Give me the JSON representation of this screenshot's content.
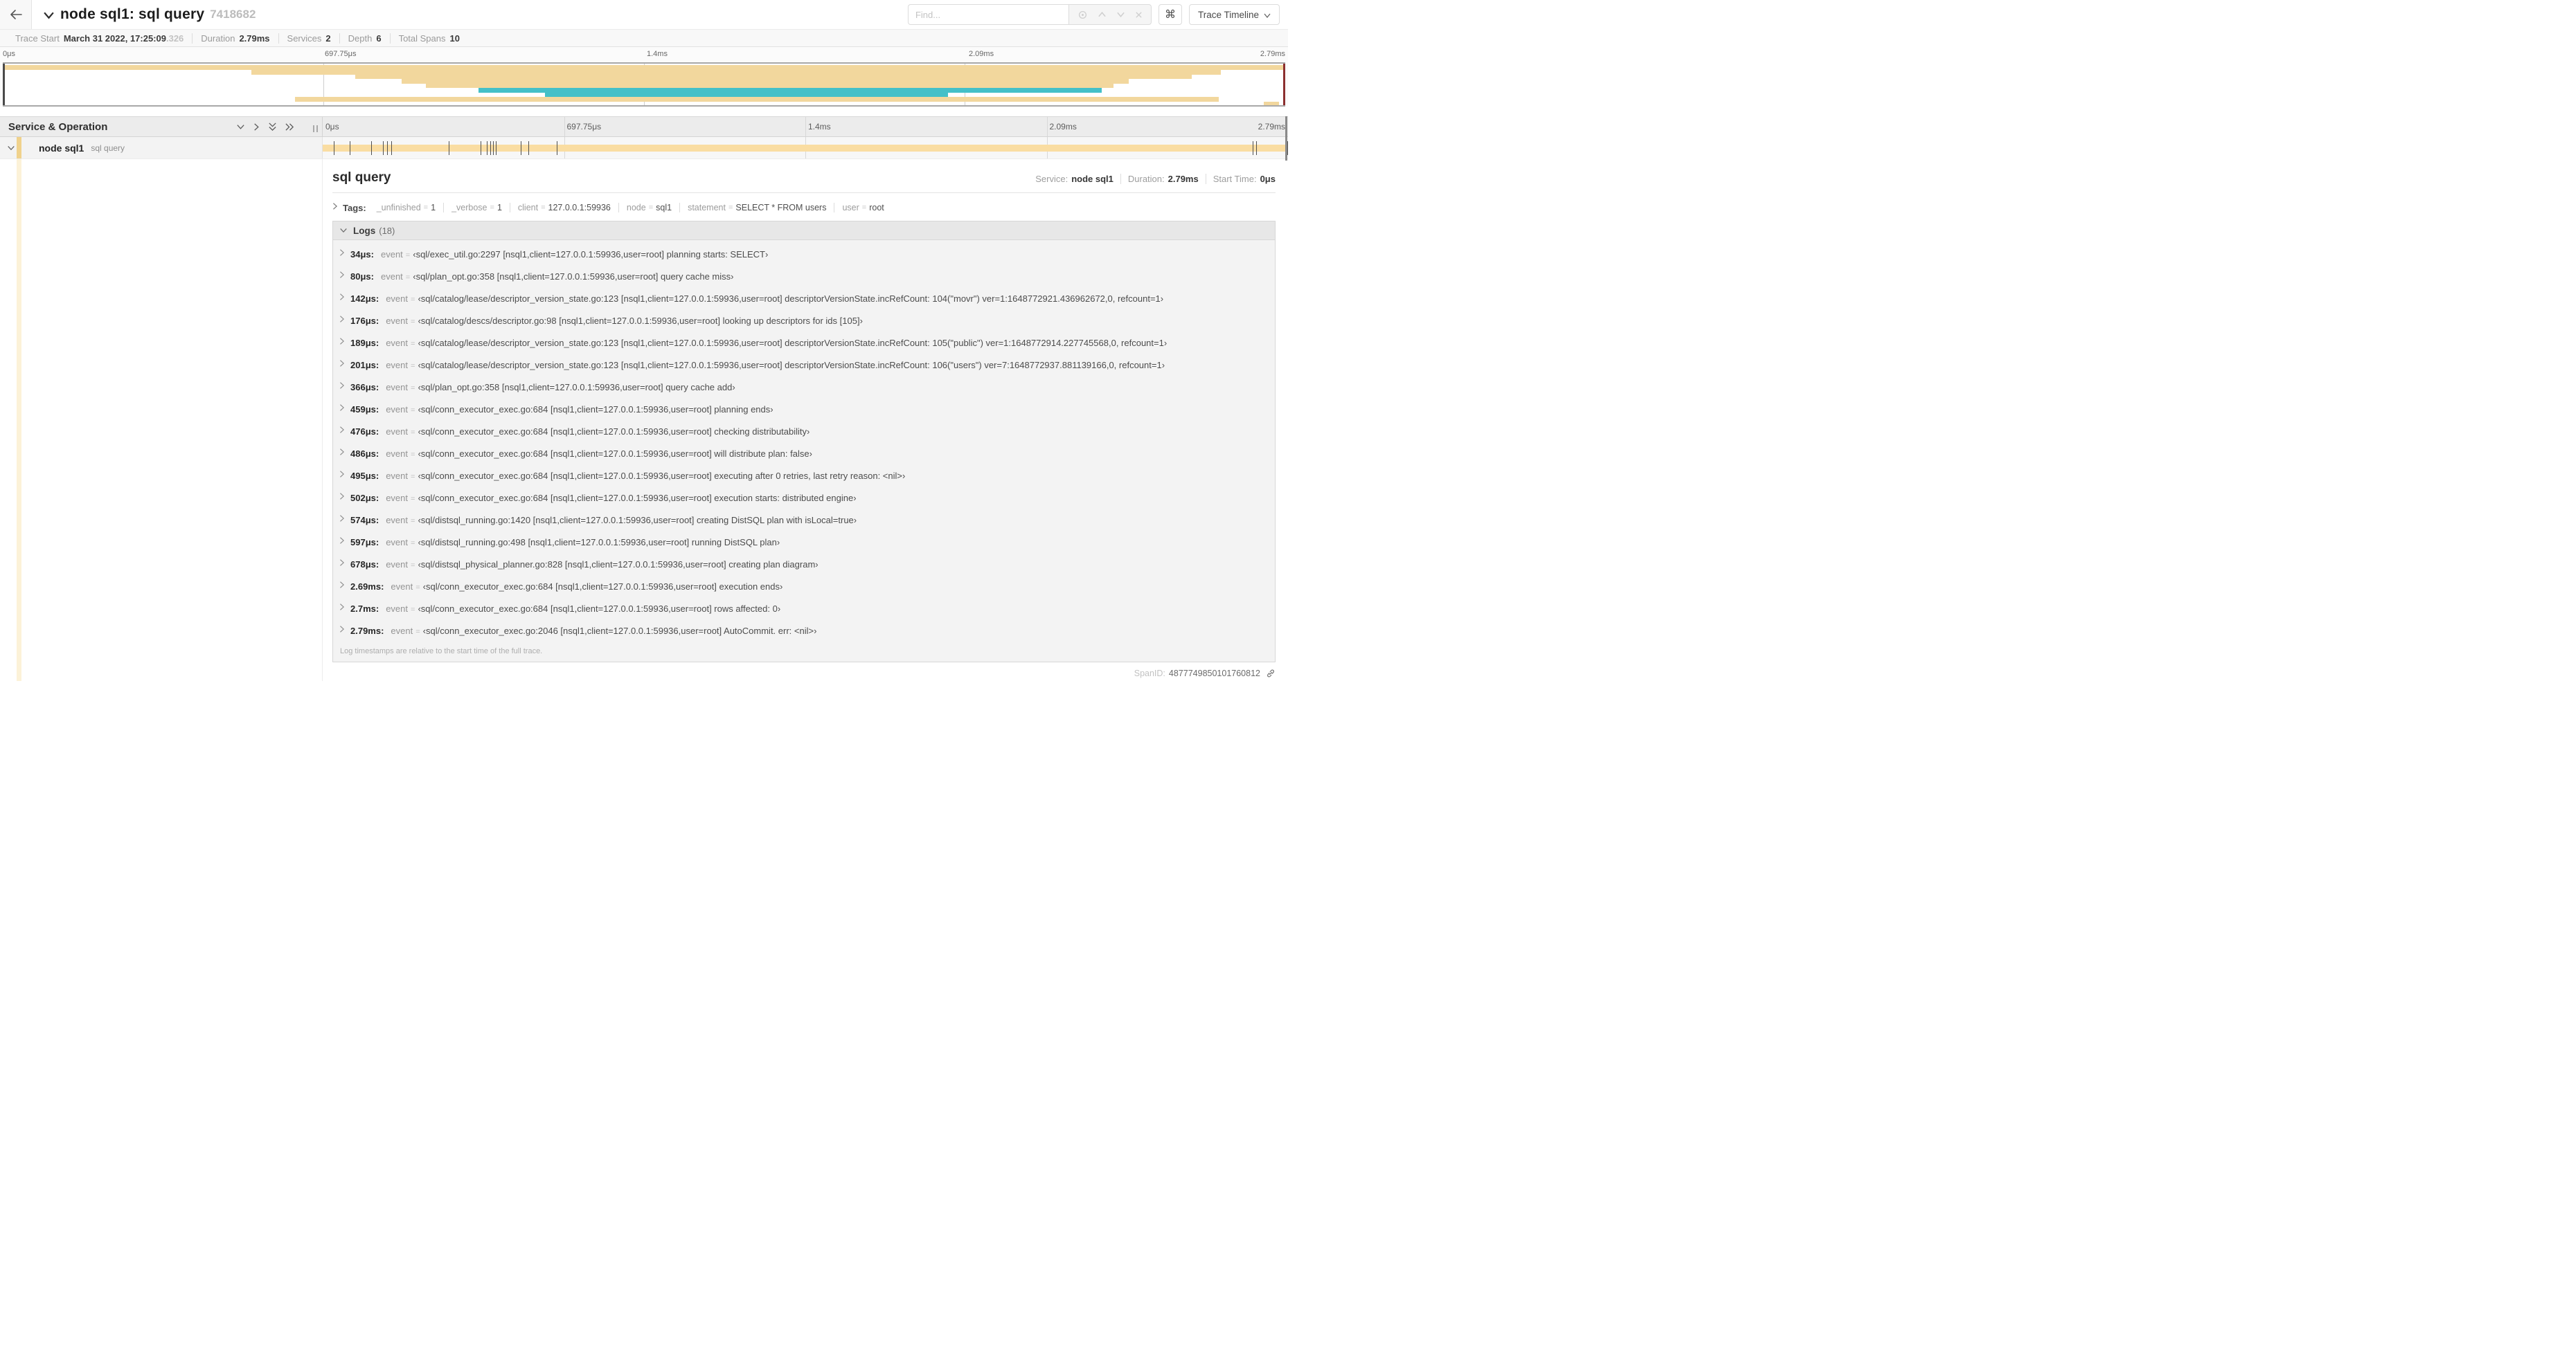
{
  "header": {
    "title": "node sql1: sql query",
    "trace_id": "7418682",
    "find_placeholder": "Find...",
    "shortcut_icon": "⌘",
    "view_label": "Trace Timeline"
  },
  "summary": {
    "items": [
      {
        "label": "Trace Start",
        "value": "March 31 2022, 17:25:09",
        "suffix": ".326"
      },
      {
        "label": "Duration",
        "value": "2.79ms"
      },
      {
        "label": "Services",
        "value": "2"
      },
      {
        "label": "Depth",
        "value": "6"
      },
      {
        "label": "Total Spans",
        "value": "10"
      }
    ]
  },
  "colors": {
    "span_tan": "#f2d79d",
    "span_teal": "#44c0c8",
    "bar_tan": "#fadda2",
    "accent_cream": "#fcf2d8",
    "accent_strong": "#f0d28c"
  },
  "time_ticks": [
    {
      "label": "0μs",
      "pos": 0
    },
    {
      "label": "697.75μs",
      "pos": 0.25
    },
    {
      "label": "1.4ms",
      "pos": 0.5
    },
    {
      "label": "2.09ms",
      "pos": 0.75
    },
    {
      "label": "2.79ms",
      "pos": 1
    }
  ],
  "minimap": {
    "spans": [
      {
        "row": 0,
        "start": 0.0,
        "end": 1.0,
        "color": "tan"
      },
      {
        "row": 1,
        "start": 0.194,
        "end": 0.95,
        "color": "tan"
      },
      {
        "row": 2,
        "start": 0.275,
        "end": 0.927,
        "color": "tan"
      },
      {
        "row": 3,
        "start": 0.311,
        "end": 0.878,
        "color": "tan"
      },
      {
        "row": 4,
        "start": 0.33,
        "end": 0.866,
        "color": "tan"
      },
      {
        "row": 5,
        "start": 0.371,
        "end": 0.857,
        "color": "teal"
      },
      {
        "row": 6,
        "start": 0.423,
        "end": 0.737,
        "color": "teal"
      },
      {
        "row": 7,
        "start": 0.228,
        "end": 0.948,
        "color": "tan"
      },
      {
        "row": 8,
        "start": 0.983,
        "end": 0.995,
        "color": "tan"
      }
    ]
  },
  "columns": {
    "service_header": "Service & Operation"
  },
  "span": {
    "service": "node sql1",
    "operation": "sql query",
    "duration_us": 2790,
    "log_tick_times_us": [
      34,
      80,
      142,
      176,
      189,
      201,
      366,
      459,
      476,
      486,
      495,
      502,
      574,
      597,
      678,
      2690,
      2700,
      2790
    ]
  },
  "detail": {
    "title": "sql query",
    "meta": [
      {
        "label": "Service:",
        "value": "node sql1"
      },
      {
        "label": "Duration:",
        "value": "2.79ms"
      },
      {
        "label": "Start Time:",
        "value": "0μs"
      }
    ],
    "tags_label": "Tags:",
    "tags": [
      {
        "key": "_unfinished",
        "value": "1"
      },
      {
        "key": "_verbose",
        "value": "1"
      },
      {
        "key": "client",
        "value": "127.0.0.1:59936"
      },
      {
        "key": "node",
        "value": "sql1"
      },
      {
        "key": "statement",
        "value": "SELECT * FROM users"
      },
      {
        "key": "user",
        "value": "root"
      }
    ],
    "logs_label": "Logs",
    "logs_count": "(18)",
    "formatting": {
      "eq": "=",
      "quote_open": "‹",
      "quote_close": "›"
    },
    "logs": [
      {
        "time": "34μs:",
        "key": "event",
        "value": "sql/exec_util.go:2297 [nsql1,client=127.0.0.1:59936,user=root] planning starts: SELECT"
      },
      {
        "time": "80μs:",
        "key": "event",
        "value": "sql/plan_opt.go:358 [nsql1,client=127.0.0.1:59936,user=root] query cache miss"
      },
      {
        "time": "142μs:",
        "key": "event",
        "value": "sql/catalog/lease/descriptor_version_state.go:123 [nsql1,client=127.0.0.1:59936,user=root] descriptorVersionState.incRefCount: 104(\"movr\") ver=1:1648772921.436962672,0, refcount=1"
      },
      {
        "time": "176μs:",
        "key": "event",
        "value": "sql/catalog/descs/descriptor.go:98 [nsql1,client=127.0.0.1:59936,user=root] looking up descriptors for ids [105]"
      },
      {
        "time": "189μs:",
        "key": "event",
        "value": "sql/catalog/lease/descriptor_version_state.go:123 [nsql1,client=127.0.0.1:59936,user=root] descriptorVersionState.incRefCount: 105(\"public\") ver=1:1648772914.227745568,0, refcount=1"
      },
      {
        "time": "201μs:",
        "key": "event",
        "value": "sql/catalog/lease/descriptor_version_state.go:123 [nsql1,client=127.0.0.1:59936,user=root] descriptorVersionState.incRefCount: 106(\"users\") ver=7:1648772937.881139166,0, refcount=1"
      },
      {
        "time": "366μs:",
        "key": "event",
        "value": "sql/plan_opt.go:358 [nsql1,client=127.0.0.1:59936,user=root] query cache add"
      },
      {
        "time": "459μs:",
        "key": "event",
        "value": "sql/conn_executor_exec.go:684 [nsql1,client=127.0.0.1:59936,user=root] planning ends"
      },
      {
        "time": "476μs:",
        "key": "event",
        "value": "sql/conn_executor_exec.go:684 [nsql1,client=127.0.0.1:59936,user=root] checking distributability"
      },
      {
        "time": "486μs:",
        "key": "event",
        "value": "sql/conn_executor_exec.go:684 [nsql1,client=127.0.0.1:59936,user=root] will distribute plan: false"
      },
      {
        "time": "495μs:",
        "key": "event",
        "value": "sql/conn_executor_exec.go:684 [nsql1,client=127.0.0.1:59936,user=root] executing after 0 retries, last retry reason: <nil>"
      },
      {
        "time": "502μs:",
        "key": "event",
        "value": "sql/conn_executor_exec.go:684 [nsql1,client=127.0.0.1:59936,user=root] execution starts: distributed engine"
      },
      {
        "time": "574μs:",
        "key": "event",
        "value": "sql/distsql_running.go:1420 [nsql1,client=127.0.0.1:59936,user=root] creating DistSQL plan with isLocal=true"
      },
      {
        "time": "597μs:",
        "key": "event",
        "value": "sql/distsql_running.go:498 [nsql1,client=127.0.0.1:59936,user=root] running DistSQL plan"
      },
      {
        "time": "678μs:",
        "key": "event",
        "value": "sql/distsql_physical_planner.go:828 [nsql1,client=127.0.0.1:59936,user=root] creating plan diagram"
      },
      {
        "time": "2.69ms:",
        "key": "event",
        "value": "sql/conn_executor_exec.go:684 [nsql1,client=127.0.0.1:59936,user=root] execution ends"
      },
      {
        "time": "2.7ms:",
        "key": "event",
        "value": "sql/conn_executor_exec.go:684 [nsql1,client=127.0.0.1:59936,user=root] rows affected: 0"
      },
      {
        "time": "2.79ms:",
        "key": "event",
        "value": "sql/conn_executor_exec.go:2046 [nsql1,client=127.0.0.1:59936,user=root] AutoCommit. err: <nil>"
      }
    ],
    "footnote": "Log timestamps are relative to the start time of the full trace.",
    "spanid_label": "SpanID:",
    "spanid": "4877749850101760812"
  }
}
